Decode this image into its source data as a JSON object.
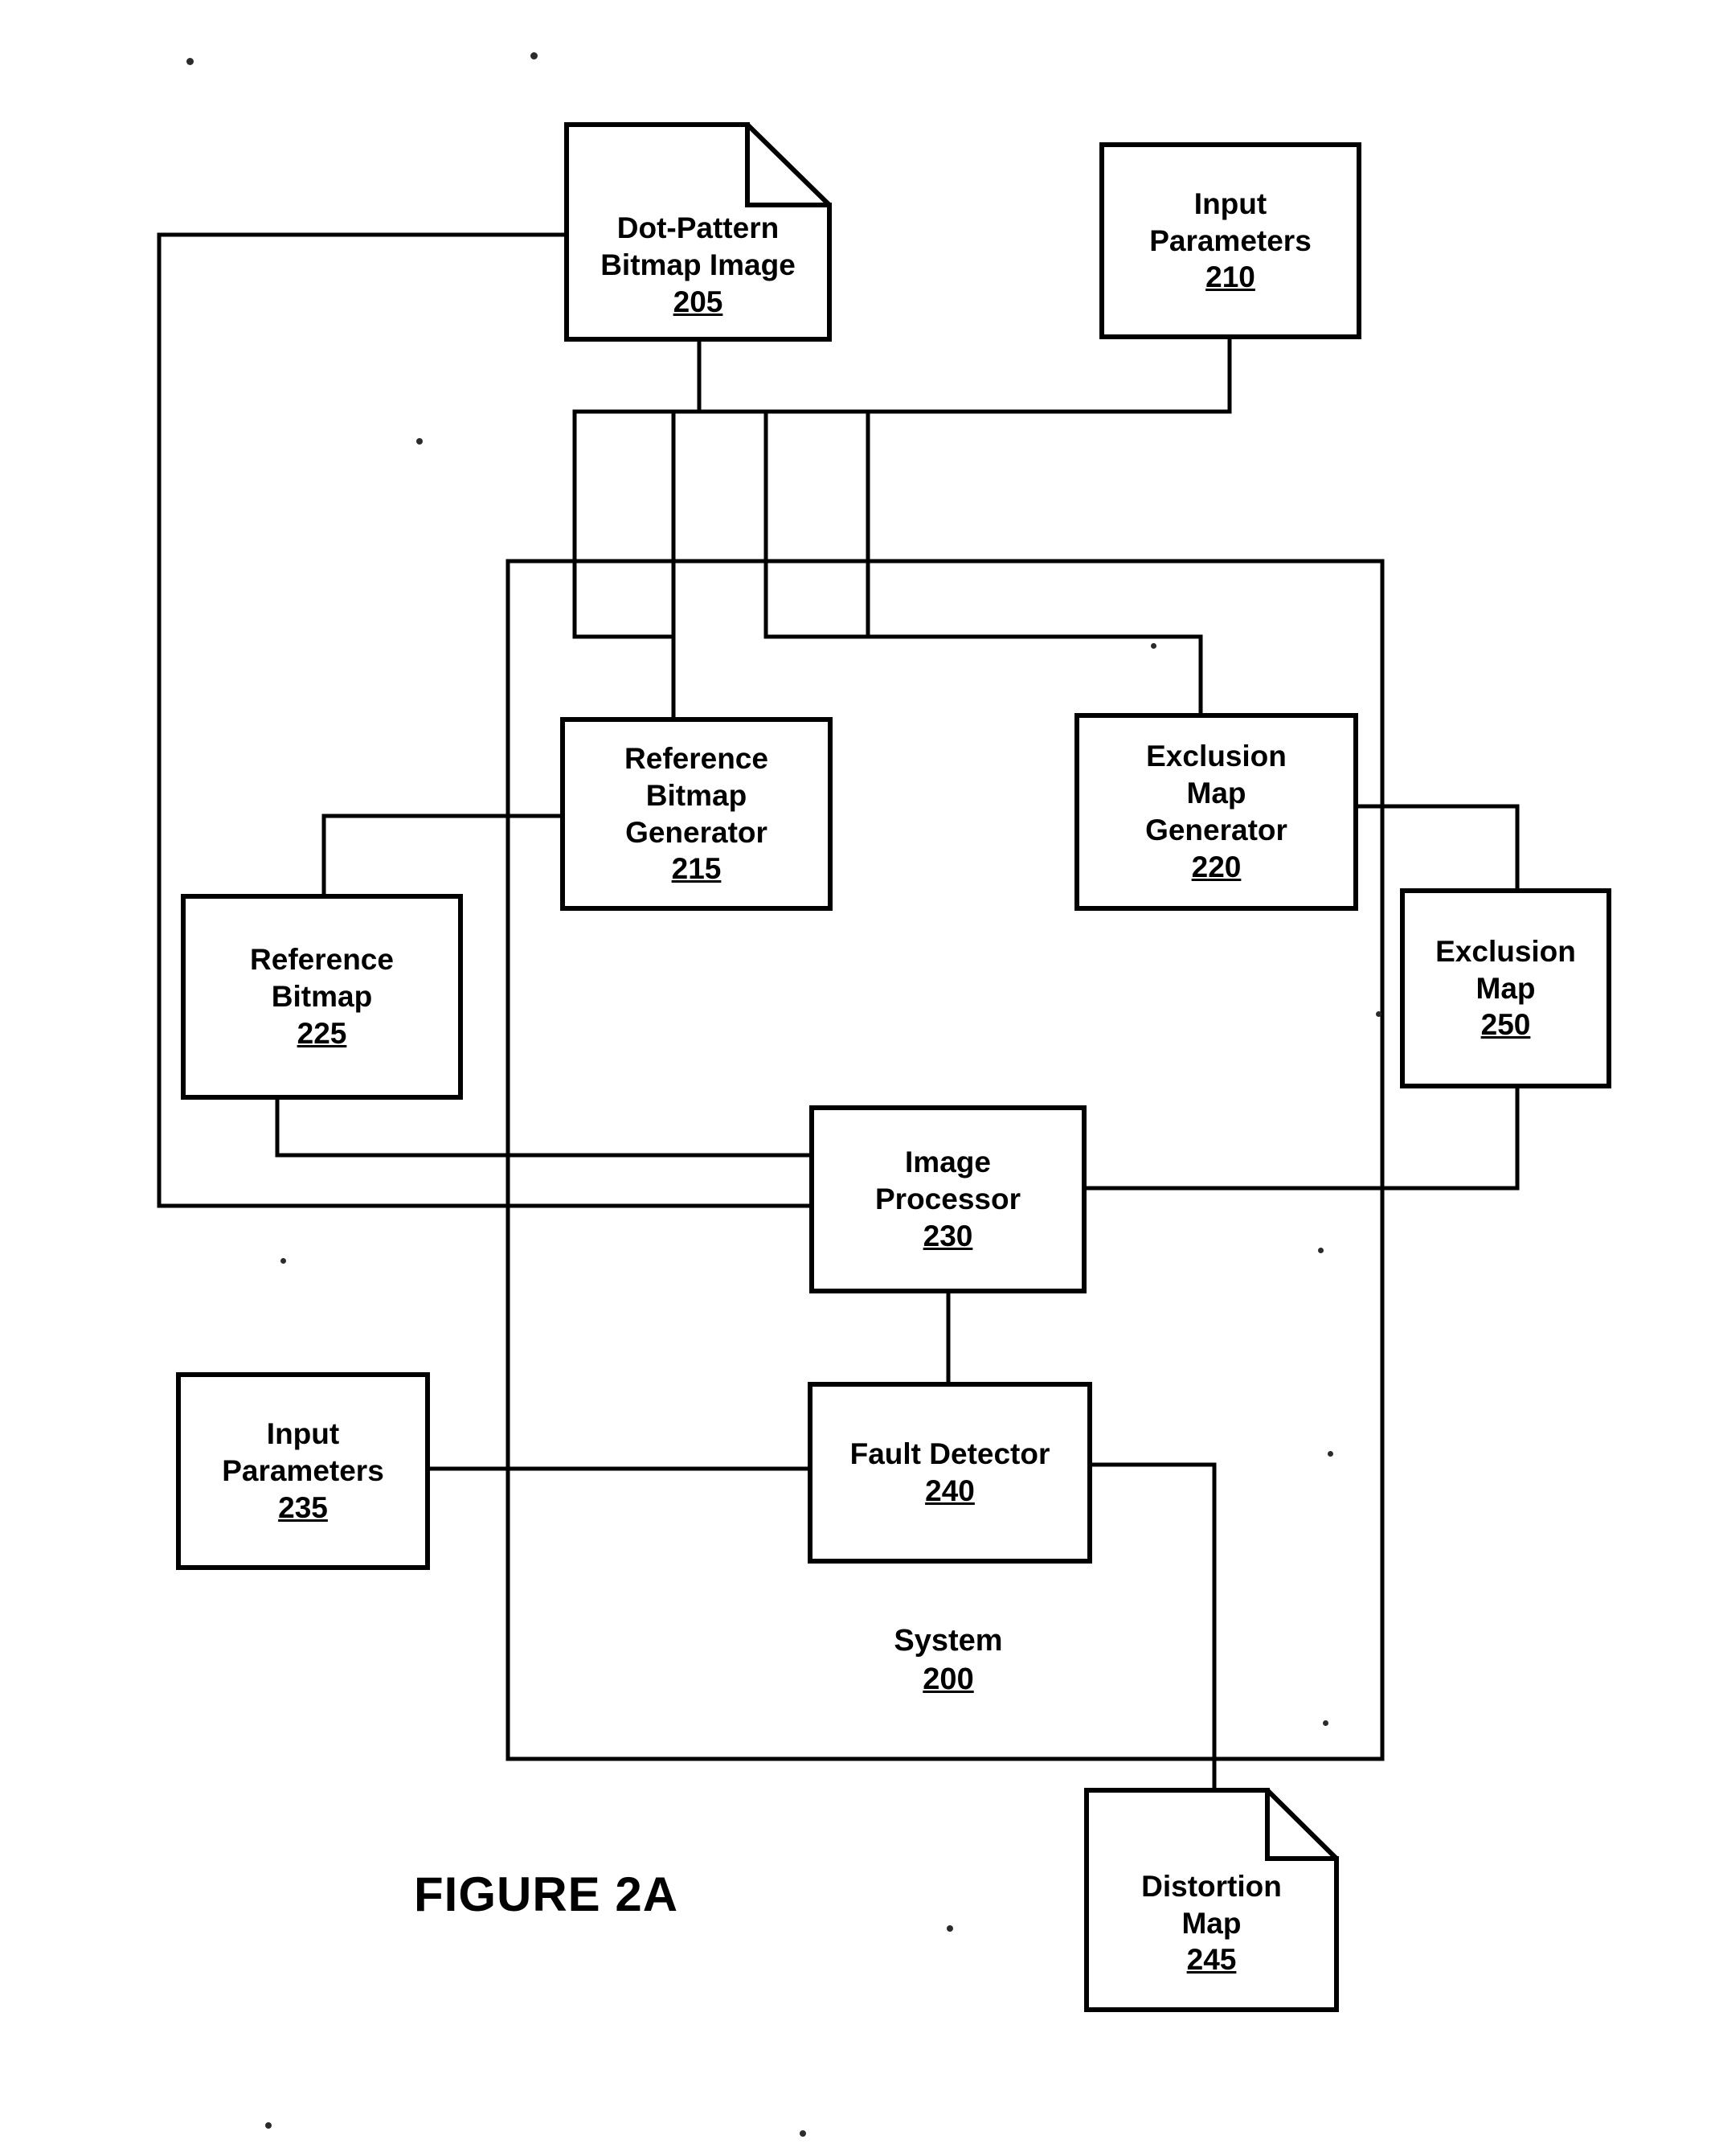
{
  "figure": {
    "caption": "FIGURE 2A"
  },
  "system": {
    "name": "System",
    "number": "200"
  },
  "nodes": [
    {
      "id": "dot-pattern-bitmap-image",
      "shape": "document",
      "title": "Dot-Pattern\nBitmap Image",
      "number": "205"
    },
    {
      "id": "input-parameters-210",
      "shape": "rect",
      "title": "Input\nParameters",
      "number": "210"
    },
    {
      "id": "reference-bitmap-generator",
      "shape": "rect",
      "title": "Reference\nBitmap\nGenerator",
      "number": "215"
    },
    {
      "id": "exclusion-map-generator",
      "shape": "rect",
      "title": "Exclusion\nMap\nGenerator",
      "number": "220"
    },
    {
      "id": "reference-bitmap",
      "shape": "rect",
      "title": "Reference\nBitmap",
      "number": "225"
    },
    {
      "id": "exclusion-map",
      "shape": "rect",
      "title": "Exclusion\nMap",
      "number": "250"
    },
    {
      "id": "image-processor",
      "shape": "rect",
      "title": "Image\nProcessor",
      "number": "230"
    },
    {
      "id": "input-parameters-235",
      "shape": "rect",
      "title": "Input\nParameters",
      "number": "235"
    },
    {
      "id": "fault-detector",
      "shape": "rect",
      "title": "Fault Detector",
      "number": "240"
    },
    {
      "id": "distortion-map",
      "shape": "document",
      "title": "Distortion\nMap",
      "number": "245"
    }
  ],
  "colors": {
    "ink": "#000000",
    "background": "#ffffff"
  }
}
